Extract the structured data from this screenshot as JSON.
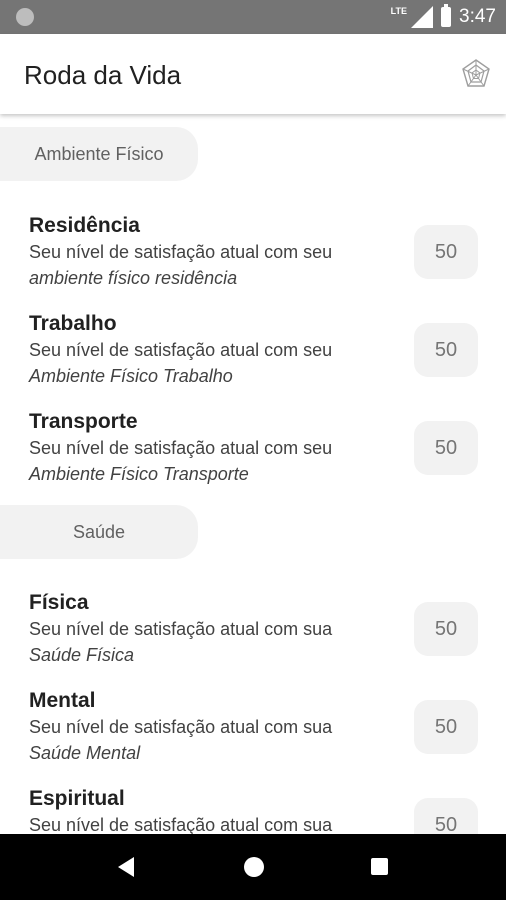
{
  "status_bar": {
    "network": "LTE",
    "time": "3:47"
  },
  "app_bar": {
    "title": "Roda da Vida",
    "icon": "life-wheel-icon"
  },
  "sections": [
    {
      "label": "Ambiente Físico",
      "items": [
        {
          "title": "Residência",
          "desc": "Seu nível de satisfação atual com seu",
          "sub": "ambiente físico residência",
          "value": "50"
        },
        {
          "title": "Trabalho",
          "desc": "Seu nível de satisfação atual com seu",
          "sub": "Ambiente Físico Trabalho",
          "value": "50"
        },
        {
          "title": "Transporte",
          "desc": "Seu nível de satisfação atual com seu",
          "sub": "Ambiente Físico Transporte",
          "value": "50"
        }
      ]
    },
    {
      "label": "Saúde",
      "items": [
        {
          "title": "Física",
          "desc": "Seu nível de satisfação atual com sua",
          "sub": "Saúde Física",
          "value": "50"
        },
        {
          "title": "Mental",
          "desc": "Seu nível de satisfação atual com sua",
          "sub": "Saúde Mental",
          "value": "50"
        },
        {
          "title": "Espiritual",
          "desc": "Seu nível de satisfação atual com sua",
          "sub": "",
          "value": "50"
        }
      ]
    }
  ],
  "nav_bar": {
    "icons": [
      "back-icon",
      "home-icon",
      "recents-icon"
    ]
  }
}
